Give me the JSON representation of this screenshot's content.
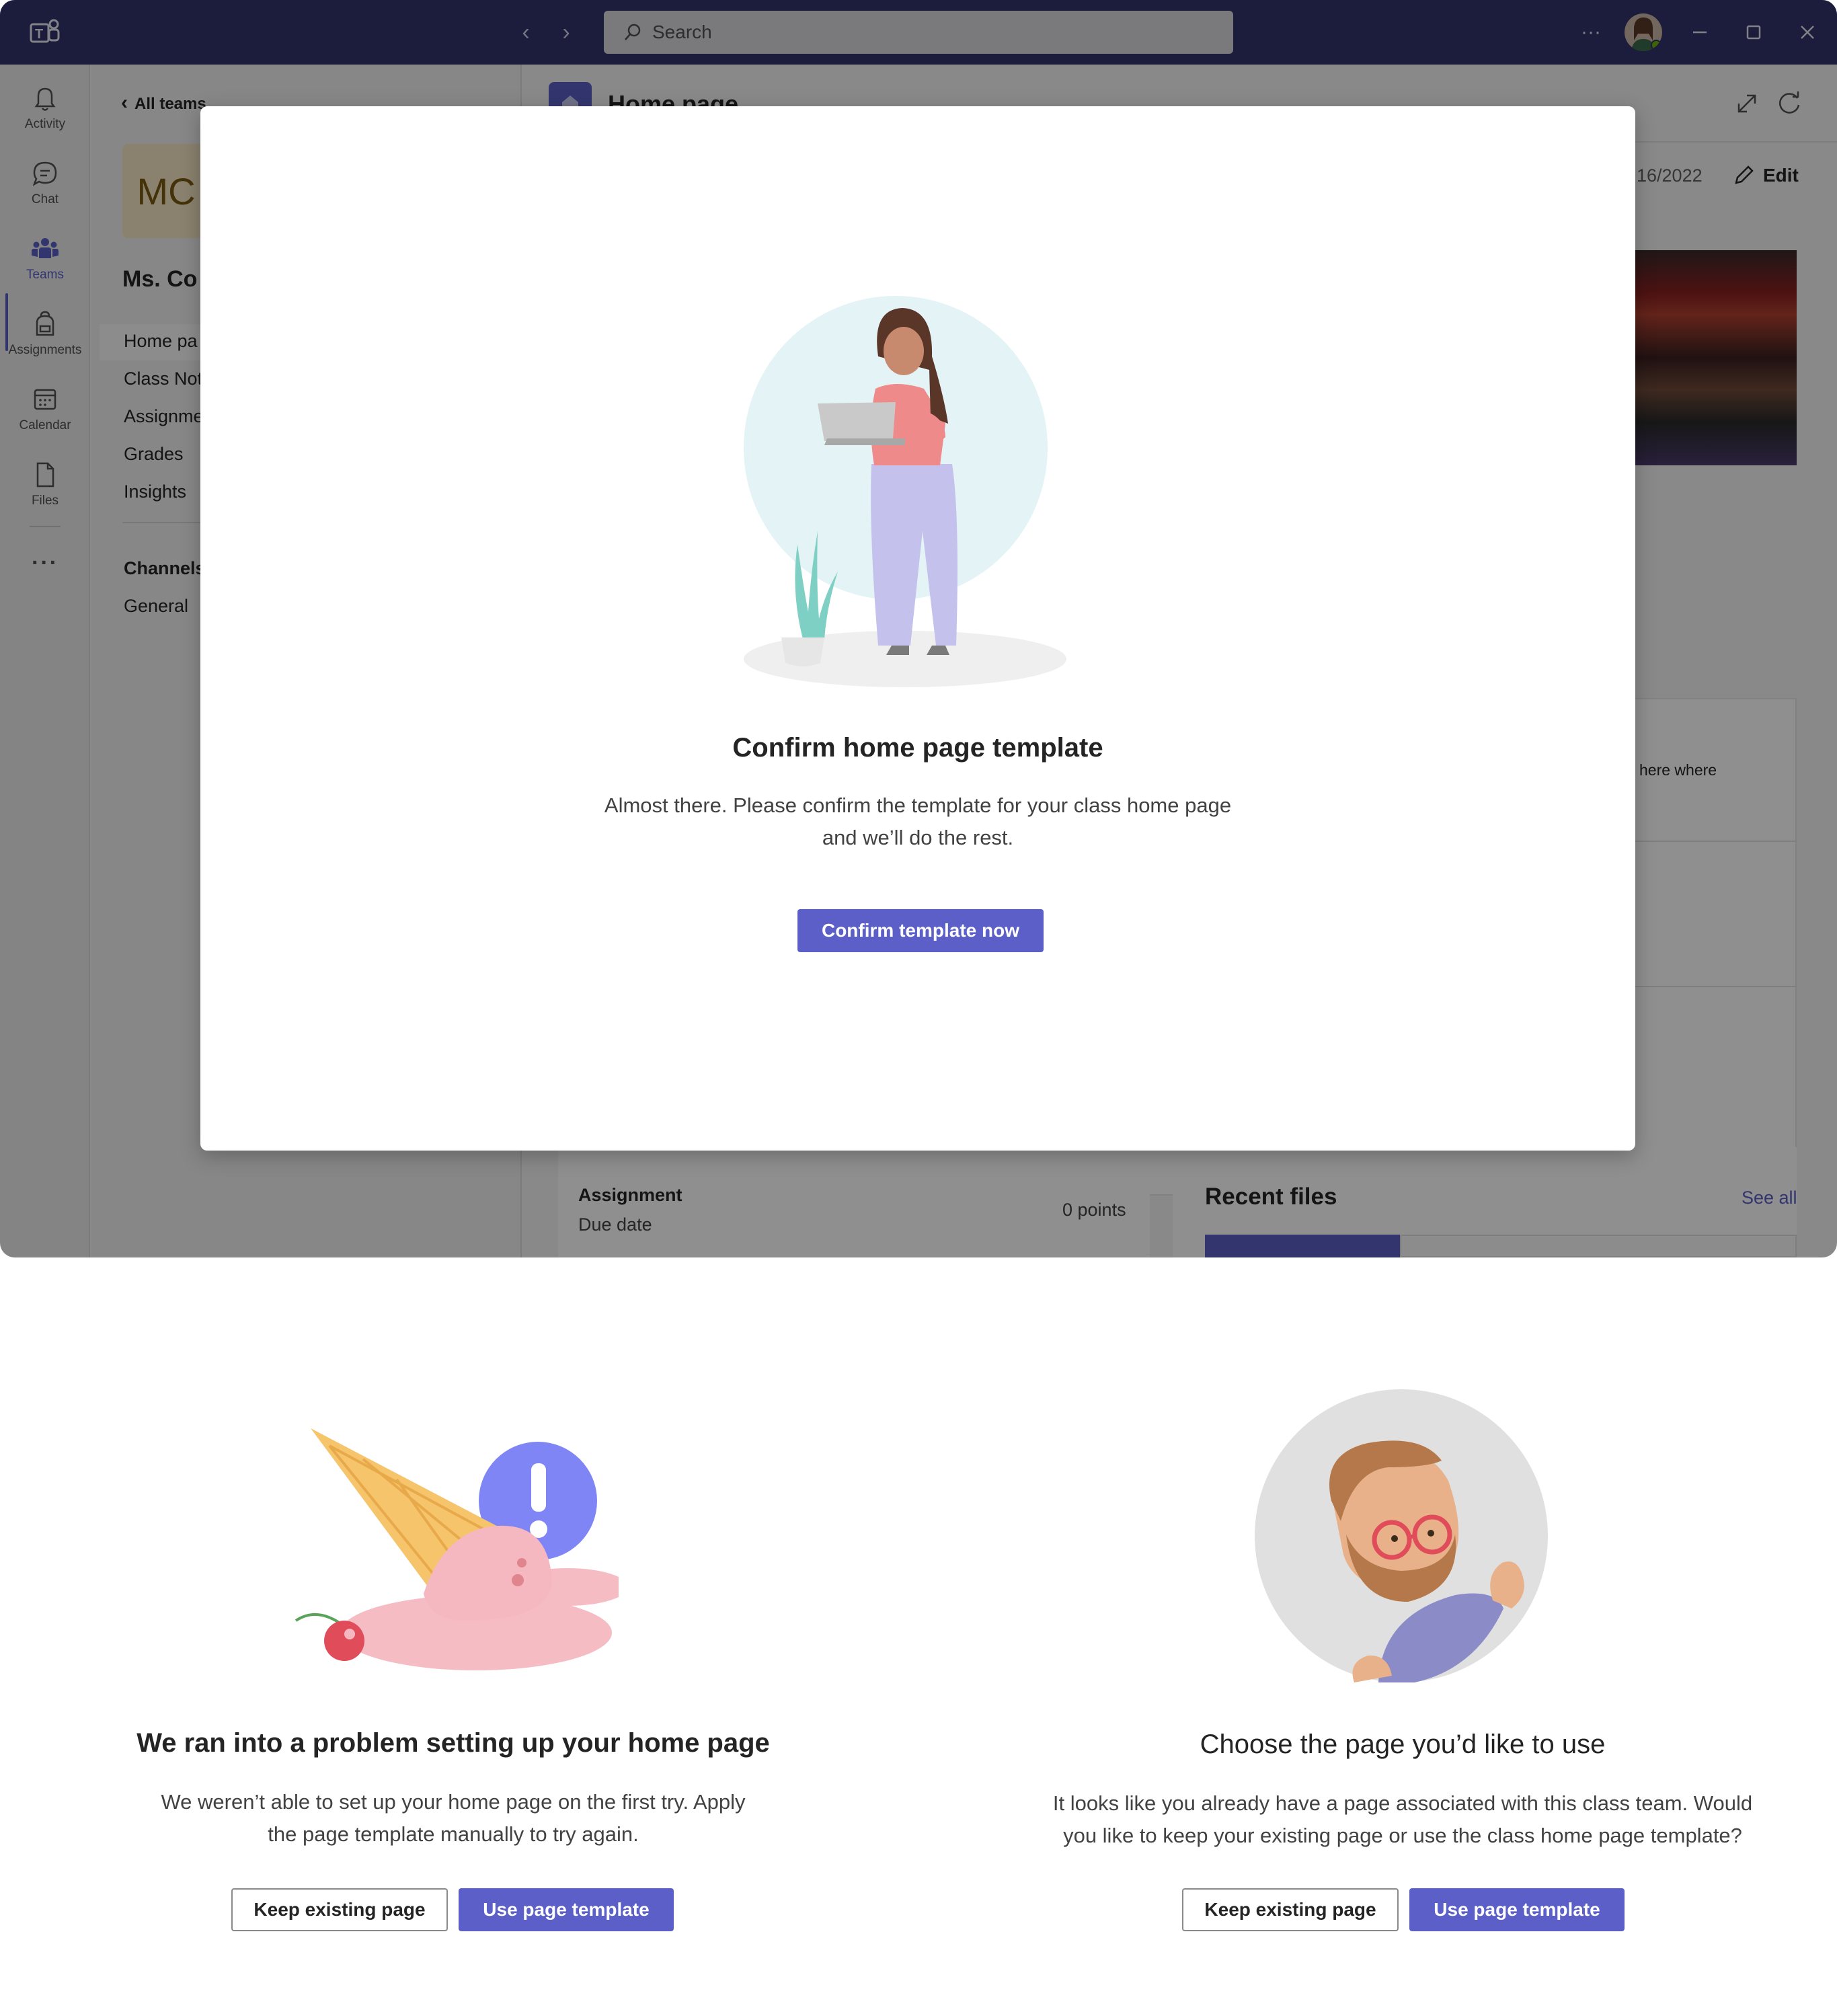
{
  "titlebar": {
    "search_placeholder": "Search",
    "more": "···",
    "back": "‹",
    "forward": "›"
  },
  "rail": {
    "items": [
      {
        "label": "Activity",
        "icon": "bell-icon"
      },
      {
        "label": "Chat",
        "icon": "chat-icon"
      },
      {
        "label": "Teams",
        "icon": "teams-icon"
      },
      {
        "label": "Assignments",
        "icon": "backpack-icon"
      },
      {
        "label": "Calendar",
        "icon": "calendar-icon"
      },
      {
        "label": "Files",
        "icon": "file-icon"
      }
    ],
    "more": "···"
  },
  "sidebar": {
    "back_label": "All teams",
    "team_initials": "MC",
    "team_name": "Ms. Co",
    "nav": [
      "Home pa",
      "Class Not",
      "Assignme",
      "Grades",
      "Insights"
    ],
    "channels_label": "Channels",
    "channels": [
      "General"
    ]
  },
  "content": {
    "page_title": "Home page",
    "date": "16/2022",
    "edit_label": "Edit",
    "partial_text": "here where",
    "assignment_label": "Assignment",
    "due_label": "Due date",
    "points": "0 points",
    "recent_files": "Recent files",
    "see_all": "See all"
  },
  "dialog": {
    "title": "Confirm home page template",
    "body_line1": "Almost there. Please confirm the template for your class home page",
    "body_line2": "and we’ll do the rest.",
    "confirm_button": "Confirm template now"
  },
  "error_panel": {
    "title": "We ran into a problem setting up your home page",
    "body_line1": "We weren’t able to set up your home page on the first try. Apply",
    "body_line2": "the page template manually to try again.",
    "keep_button": "Keep existing page",
    "use_button": "Use page template"
  },
  "choose_panel": {
    "title": "Choose the page you’d like to use",
    "body_line1": "It looks like you already have a page associated with this class team. Would",
    "body_line2": "you like to keep your existing page or use the class home page template?",
    "keep_button": "Keep existing page",
    "use_button": "Use page template"
  },
  "colors": {
    "titlebar": "#33346b",
    "accent": "#5b5fc7",
    "overlay": "rgba(0,0,0,0.44)"
  }
}
